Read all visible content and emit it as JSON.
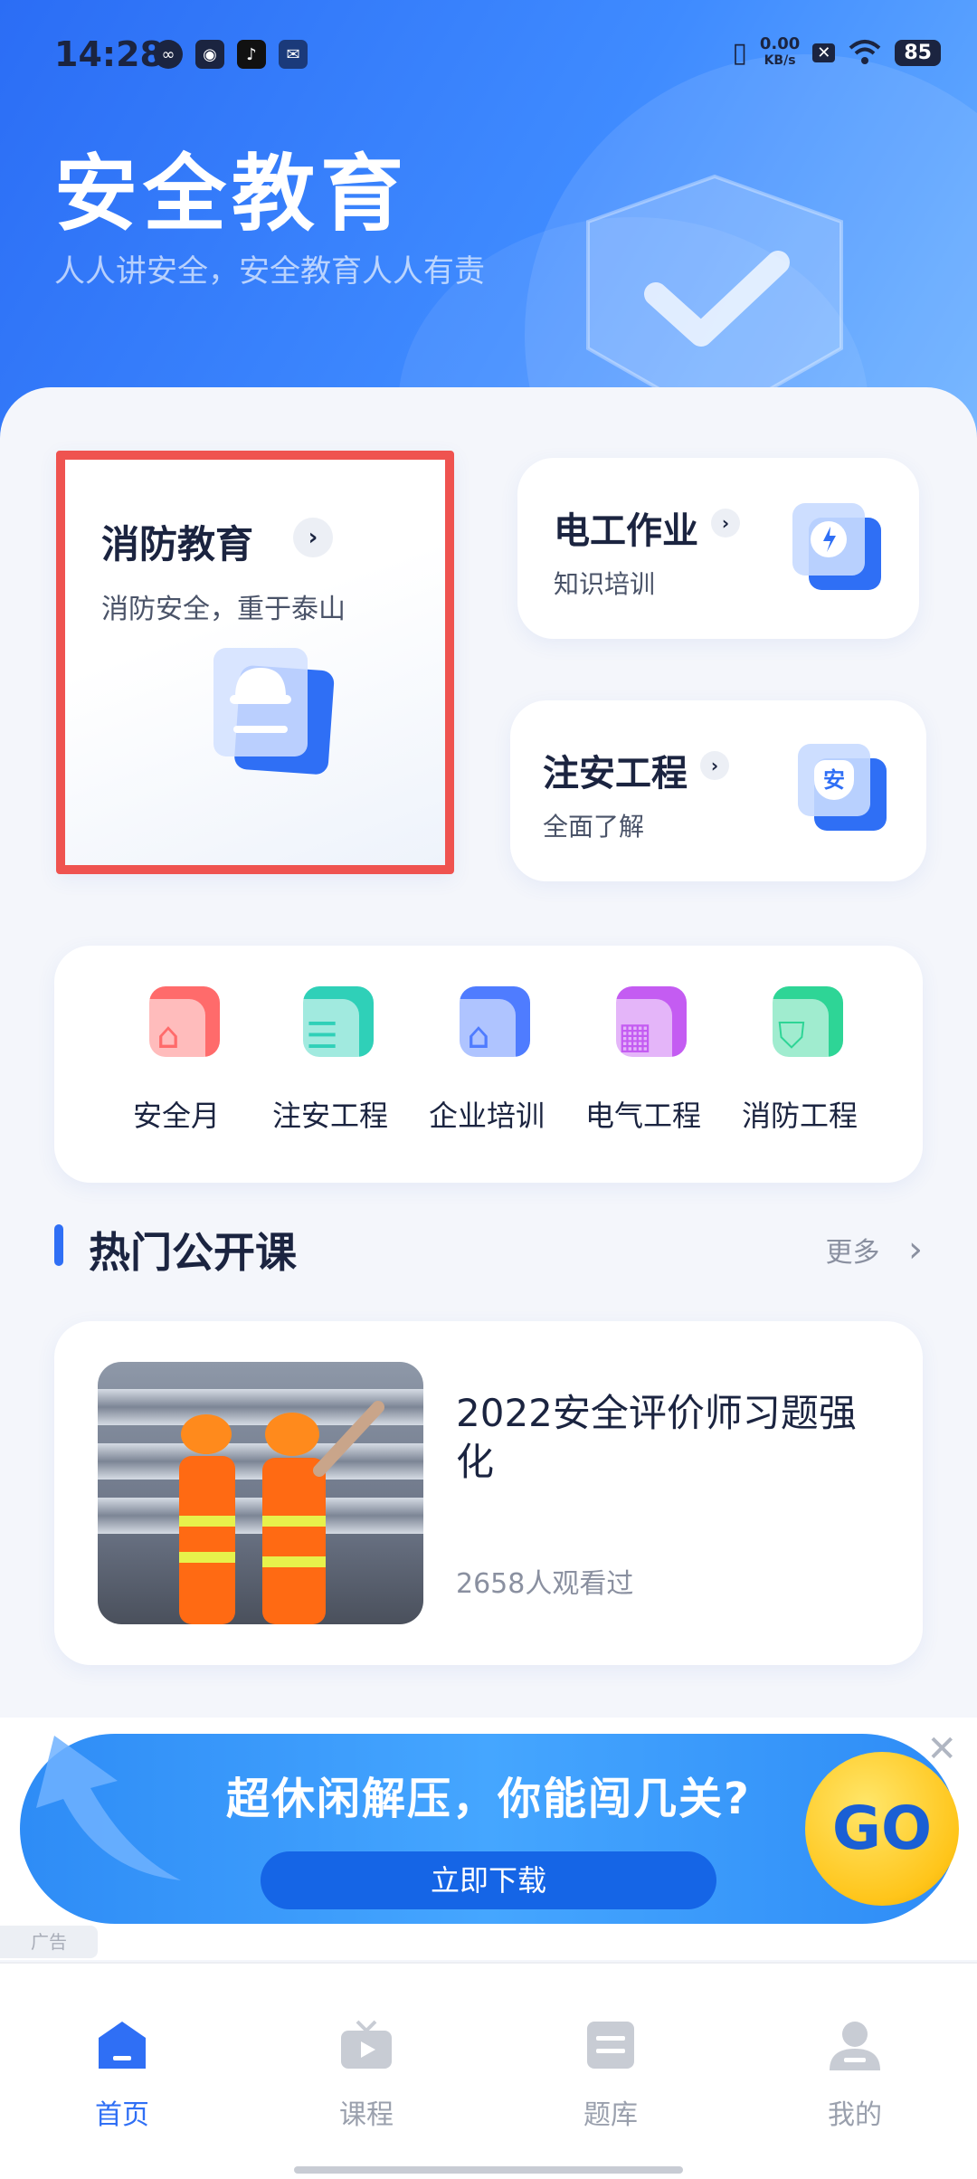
{
  "status_bar": {
    "time": "14:28",
    "net_speed_value": "0.00",
    "net_speed_unit": "KB/s",
    "battery": "85"
  },
  "hero": {
    "title": "安全教育",
    "subtitle": "人人讲安全，安全教育人人有责"
  },
  "feature_cards": [
    {
      "title": "消防教育",
      "subtitle": "消防安全，重于泰山",
      "icon": "helmet-icon",
      "chevron": "›"
    },
    {
      "title": "电工作业",
      "subtitle": "知识培训",
      "icon": "plug-icon",
      "chevron": "›"
    },
    {
      "title": "注安工程",
      "subtitle": "全面了解",
      "icon": "shield-badge-icon",
      "badge": "安",
      "chevron": "›"
    }
  ],
  "categories": [
    {
      "label": "安全月",
      "icon": "building-arch-icon",
      "color": "#ff6b6b"
    },
    {
      "label": "注安工程",
      "icon": "person-list-icon",
      "color": "#2fd0b8"
    },
    {
      "label": "企业培训",
      "icon": "house-icon",
      "color": "#4f7cff"
    },
    {
      "label": "电气工程",
      "icon": "office-building-icon",
      "color": "#c45cf2"
    },
    {
      "label": "消防工程",
      "icon": "lock-shield-icon",
      "color": "#2ed596"
    }
  ],
  "section": {
    "title": "热门公开课",
    "more": "更多",
    "more_chevron": "›"
  },
  "course": {
    "title": "2022安全评价师习题强化",
    "views": "2658人观看过"
  },
  "ad": {
    "title": "超休闲解压，你能闯几关?",
    "button": "立即下载",
    "tag": "广告",
    "go": "GO",
    "close": "✕"
  },
  "tabs": [
    {
      "label": "首页",
      "icon": "home-icon",
      "active": true
    },
    {
      "label": "课程",
      "icon": "tv-play-icon",
      "active": false
    },
    {
      "label": "题库",
      "icon": "question-bank-icon",
      "active": false
    },
    {
      "label": "我的",
      "icon": "user-icon",
      "active": false
    }
  ],
  "colors": {
    "primary": "#2f6ff5",
    "highlight_border": "#ef5350"
  }
}
